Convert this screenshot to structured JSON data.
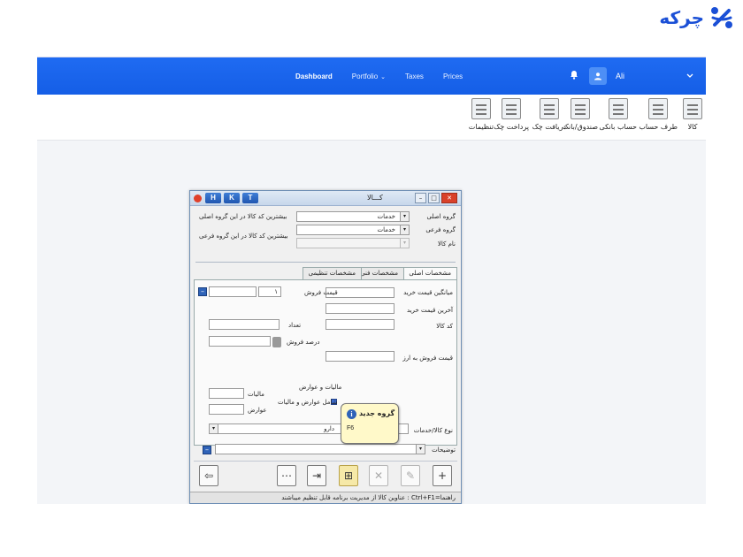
{
  "brand": {
    "name": "چرکه",
    "color": "#1a4fd6"
  },
  "topbar": {
    "nav": [
      {
        "label": "Dashboard",
        "active": true
      },
      {
        "label": "Portfolio",
        "caret": "⌄"
      },
      {
        "label": "Taxes"
      },
      {
        "label": "Prices"
      }
    ],
    "user": "Ali",
    "accent": "#1f6bf2"
  },
  "toolbar": {
    "items": [
      "کالا",
      "طرف حساب",
      "حساب بانکی",
      "صندوق/بانک",
      "دریافت چک",
      "پرداخت چک",
      "تنظیمات"
    ]
  },
  "dialog": {
    "hkt": [
      "H",
      "K",
      "T"
    ],
    "title": "کـــالا",
    "fields": {
      "main_group_label": "گروه اصلی",
      "main_group_value": "خدمات",
      "sub_group_label": "گروه فرعی",
      "sub_group_value": "خدمات",
      "name_label": "نام کالا",
      "max_code_main": "بیشترین کد کالا در این گروه اصلی",
      "max_code_sub": "بیشترین کد کالا در این گروه فرعی"
    },
    "tabs": [
      "مشخصات اصلی",
      "مشخصات فنی",
      "مشخصات تنظیمی"
    ],
    "tab_body": {
      "avg_buy": "میانگین قیمت خرید",
      "last_buy": "آخرین قیمت خرید",
      "code": "کد کالا",
      "sell_price_from": "قیمت فروش به ارز",
      "sell_price": "قیمت فروش",
      "count": "تعداد",
      "sell_percent": "درصد فروش",
      "unit_value": "۱",
      "taxes_group": "مالیات و عوارض",
      "tax": "مالیات",
      "duty": "عوارض",
      "includes": "شامل عوارض و مالیات",
      "type_label": "نوع کالا/خدمات",
      "type_value": "دارو"
    },
    "description_label": "توضیحات",
    "popup": {
      "title": "گروه جدید",
      "shortcut": "F6"
    },
    "status": "راهنما=Ctrl+F1 : عناوین کالا از مدیریت برنامه قابل تنظیم میباشند"
  }
}
